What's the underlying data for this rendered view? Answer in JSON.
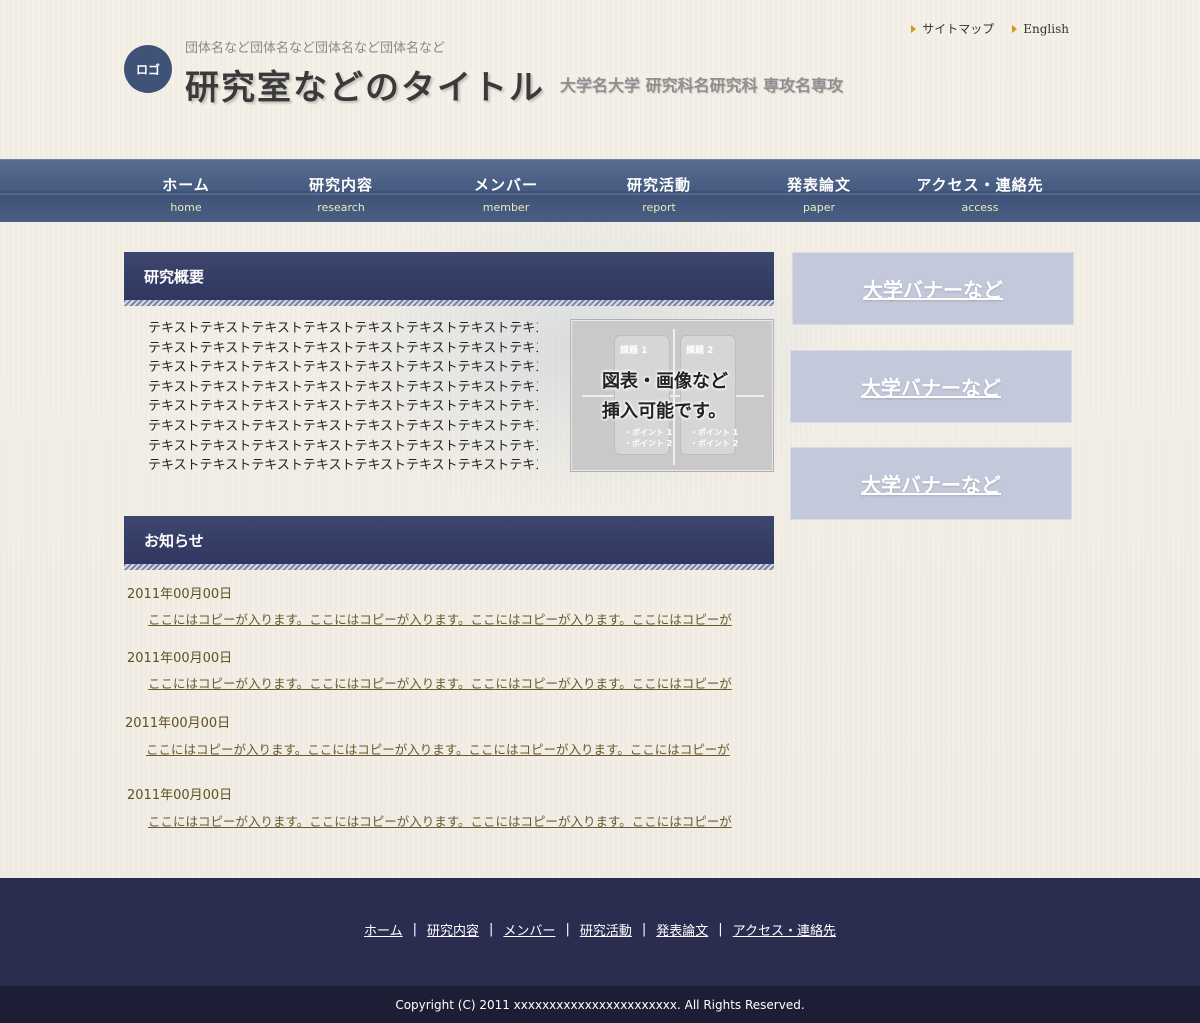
{
  "header": {
    "util_links": [
      {
        "label": "サイトマップ"
      },
      {
        "label": "English"
      }
    ],
    "logo_text": "ロゴ",
    "org_name": "団体名など団体名など団体名など団体名など",
    "site_title": "研究室などのタイトル",
    "department": "大学名大学 研究科名研究科 専攻名専攻"
  },
  "nav": [
    {
      "ja": "ホーム",
      "en": "home"
    },
    {
      "ja": "研究内容",
      "en": "research"
    },
    {
      "ja": "メンバー",
      "en": "member"
    },
    {
      "ja": "研究活動",
      "en": "report"
    },
    {
      "ja": "発表論文",
      "en": "paper"
    },
    {
      "ja": "アクセス・連絡先",
      "en": "access"
    }
  ],
  "overview": {
    "heading": "研究概要",
    "lines": [
      "テキストテキストテキストテキストテキストテキストテキストテキスト",
      "テキストテキストテキストテキストテキストテキストテキストテキスト",
      "テキストテキストテキストテキストテキストテキストテキストテキスト",
      "テキストテキストテキストテキストテキストテキストテキストテキスト",
      "テキストテキストテキストテキストテキストテキストテキストテキスト",
      "テキストテキストテキストテキストテキストテキストテキストテキスト",
      "テキストテキストテキストテキストテキストテキストテキストテキスト",
      "テキストテキストテキストテキストテキストテキストテキストテキスト"
    ],
    "image": {
      "cell1_title": "課題 1",
      "cell2_title": "課題 2",
      "point1": "・ポイント 1",
      "point2": "・ポイント 2",
      "caption_line1": "図表・画像など",
      "caption_line2": "挿入可能です。"
    }
  },
  "banners": [
    {
      "label": "大学バナーなど"
    },
    {
      "label": "大学バナーなど"
    },
    {
      "label": "大学バナーなど"
    }
  ],
  "news": {
    "heading": "お知らせ",
    "items": [
      {
        "date": "2011年00月00日",
        "text": "ここにはコピーが入ります。ここにはコピーが入ります。ここにはコピーが入ります。ここにはコピーが"
      },
      {
        "date": "2011年00月00日",
        "text": "ここにはコピーが入ります。ここにはコピーが入ります。ここにはコピーが入ります。ここにはコピーが"
      },
      {
        "date": "2011年00月00日",
        "text": "ここにはコピーが入ります。ここにはコピーが入ります。ここにはコピーが入ります。ここにはコピーが"
      },
      {
        "date": "2011年00月00日",
        "text": "ここにはコピーが入ります。ここにはコピーが入ります。ここにはコピーが入ります。ここにはコピーが"
      }
    ]
  },
  "footer": {
    "links": [
      {
        "label": "ホーム"
      },
      {
        "label": "研究内容"
      },
      {
        "label": "メンバー"
      },
      {
        "label": "研究活動"
      },
      {
        "label": "発表論文"
      },
      {
        "label": "アクセス・連絡先"
      }
    ],
    "separator": "|",
    "copyright": "Copyright (C) 2011 xxxxxxxxxxxxxxxxxxxxxxx. All Rights Reserved."
  },
  "colors": {
    "nav_bg": "#455a80",
    "section_head_bg": "#2f3760",
    "banner_bg": "#c3c9db",
    "footer_bg": "#2b2d50",
    "copyright_bg": "#1d1e35",
    "accent_arrow": "#d09a1b"
  }
}
